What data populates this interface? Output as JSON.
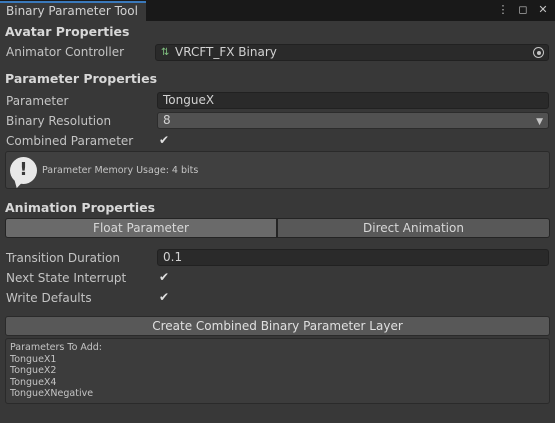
{
  "window": {
    "tab_title": "Binary Parameter Tool",
    "tab_icons": [
      "kebab-menu-icon",
      "maximize-icon",
      "close-icon"
    ]
  },
  "avatar": {
    "header": "Avatar Properties",
    "animator_label": "Animator Controller",
    "animator_value": "VRCFT_FX Binary"
  },
  "parameter": {
    "header": "Parameter Properties",
    "parameter_label": "Parameter",
    "parameter_value": "TongueX",
    "resolution_label": "Binary Resolution",
    "resolution_value": "8",
    "combined_label": "Combined Parameter",
    "combined_checked": true,
    "help_text": "Parameter Memory Usage: 4 bits"
  },
  "animation": {
    "header": "Animation Properties",
    "mode_float": "Float Parameter",
    "mode_direct": "Direct Animation",
    "selected_mode": "Float Parameter",
    "duration_label": "Transition Duration",
    "duration_value": "0.1",
    "interrupt_label": "Next State Interrupt",
    "interrupt_checked": true,
    "write_defaults_label": "Write Defaults",
    "write_defaults_checked": true
  },
  "action": {
    "create_button": "Create Combined Binary Parameter Layer",
    "list_title": "Parameters To Add:",
    "items": [
      "TongueX1",
      "TongueX2",
      "TongueX4",
      "TongueXNegative"
    ]
  },
  "colors": {
    "background": "#383838",
    "tab_accent": "#3a79bb"
  }
}
